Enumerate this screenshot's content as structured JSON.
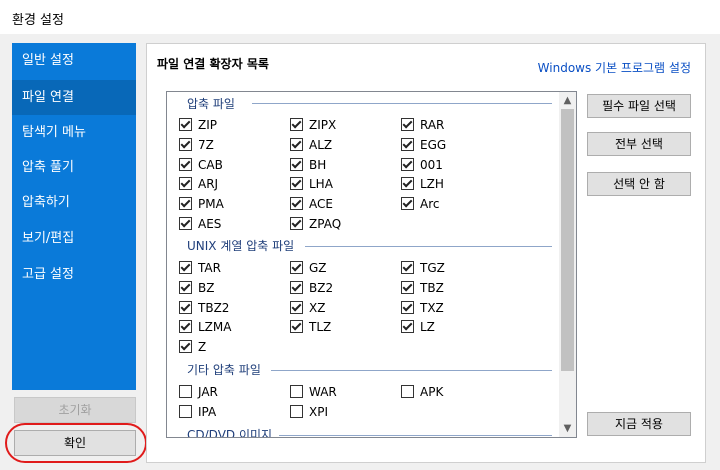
{
  "window": {
    "title": "환경 설정"
  },
  "sidebar": {
    "items": [
      {
        "label": "일반 설정"
      },
      {
        "label": "파일 연결"
      },
      {
        "label": "탐색기 메뉴"
      },
      {
        "label": "압축 풀기"
      },
      {
        "label": "압축하기"
      },
      {
        "label": "보기/편집"
      },
      {
        "label": "고급 설정"
      }
    ],
    "selected": "파일 연결"
  },
  "footer": {
    "reset_label": "초기화",
    "ok_label": "확인"
  },
  "panel": {
    "title": "파일 연결 확장자 목록",
    "link": "Windows 기본 프로그램 설정",
    "buttons": {
      "required": "필수 파일 선택",
      "all": "전부 선택",
      "none": "선택 안 함",
      "apply": "지금 적용"
    }
  },
  "groups": [
    {
      "name": "압축 파일",
      "items": [
        {
          "label": "ZIP",
          "checked": true
        },
        {
          "label": "ZIPX",
          "checked": true
        },
        {
          "label": "RAR",
          "checked": true
        },
        {
          "label": "7Z",
          "checked": true
        },
        {
          "label": "ALZ",
          "checked": true
        },
        {
          "label": "EGG",
          "checked": true
        },
        {
          "label": "CAB",
          "checked": true
        },
        {
          "label": "BH",
          "checked": true
        },
        {
          "label": "001",
          "checked": true
        },
        {
          "label": "ARJ",
          "checked": true
        },
        {
          "label": "LHA",
          "checked": true
        },
        {
          "label": "LZH",
          "checked": true
        },
        {
          "label": "PMA",
          "checked": true
        },
        {
          "label": "ACE",
          "checked": true
        },
        {
          "label": "Arc",
          "checked": true
        },
        {
          "label": "AES",
          "checked": true
        },
        {
          "label": "ZPAQ",
          "checked": true
        }
      ]
    },
    {
      "name": "UNIX 계열 압축 파일",
      "items": [
        {
          "label": "TAR",
          "checked": true
        },
        {
          "label": "GZ",
          "checked": true
        },
        {
          "label": "TGZ",
          "checked": true
        },
        {
          "label": "BZ",
          "checked": true
        },
        {
          "label": "BZ2",
          "checked": true
        },
        {
          "label": "TBZ",
          "checked": true
        },
        {
          "label": "TBZ2",
          "checked": true
        },
        {
          "label": "XZ",
          "checked": true
        },
        {
          "label": "TXZ",
          "checked": true
        },
        {
          "label": "LZMA",
          "checked": true
        },
        {
          "label": "TLZ",
          "checked": true
        },
        {
          "label": "LZ",
          "checked": true
        },
        {
          "label": "Z",
          "checked": true
        }
      ]
    },
    {
      "name": "기타 압축 파일",
      "items": [
        {
          "label": "JAR",
          "checked": false
        },
        {
          "label": "WAR",
          "checked": false
        },
        {
          "label": "APK",
          "checked": false
        },
        {
          "label": "IPA",
          "checked": false
        },
        {
          "label": "XPI",
          "checked": false
        }
      ]
    },
    {
      "name": "CD/DVD 이미지",
      "items": []
    }
  ],
  "icons": {
    "scroll_up": "chevron-up-icon",
    "scroll_down": "chevron-down-icon",
    "check": "checkmark-icon"
  }
}
